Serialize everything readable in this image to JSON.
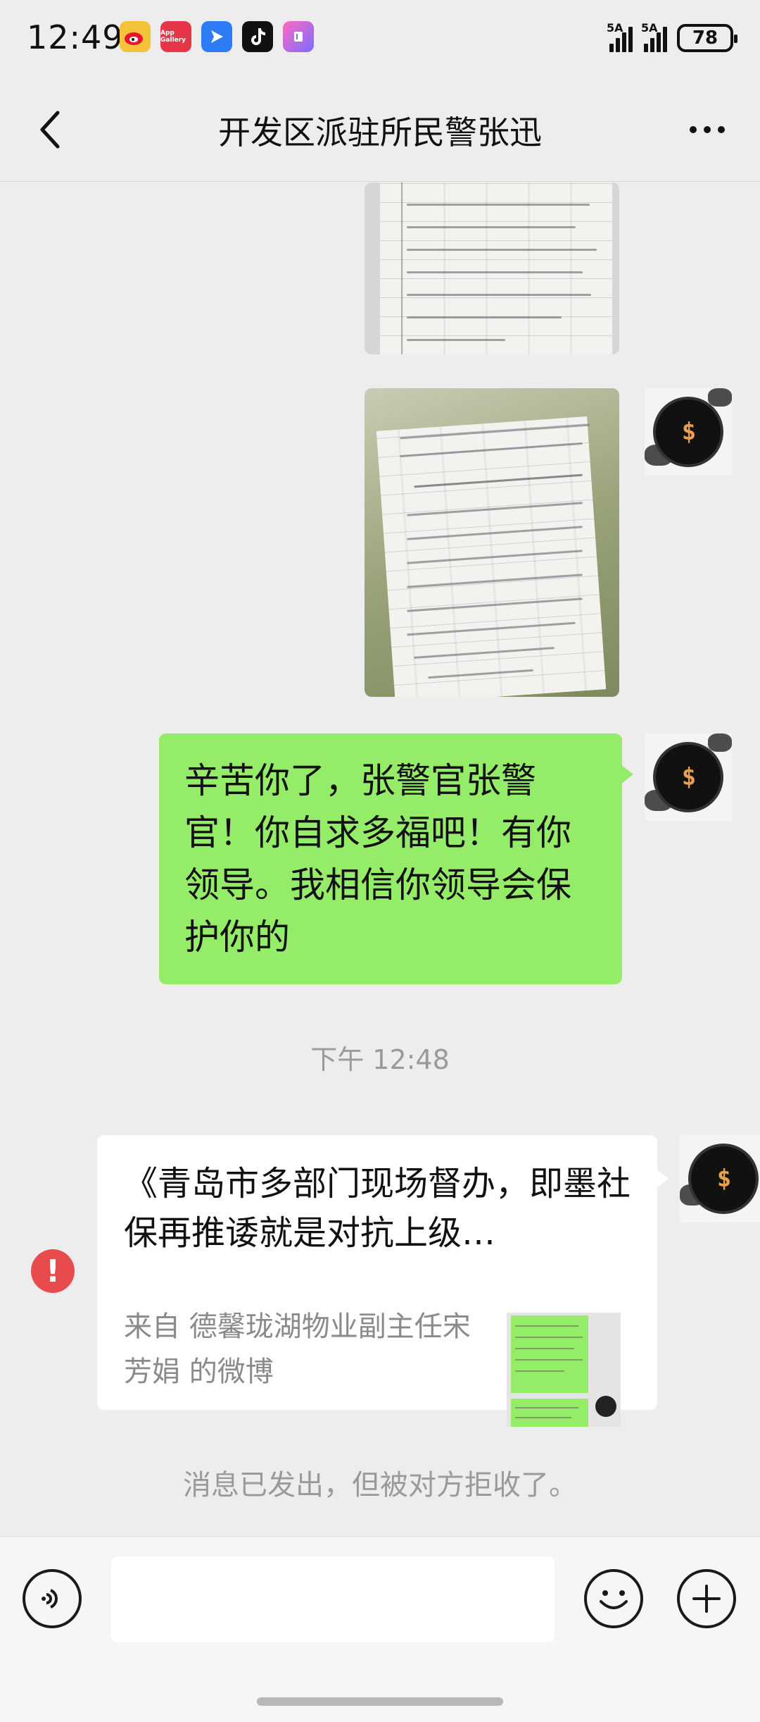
{
  "status_bar": {
    "time": "12:49",
    "app_icons": [
      "weibo-icon",
      "appgallery-icon",
      "direct-icon",
      "tiktok-icon",
      "app-icon"
    ],
    "app_gallery_label": "App Gallery",
    "sim1_label": "5A",
    "sim2_label": "5A",
    "battery": "78"
  },
  "header": {
    "title": "开发区派驻所民警张迅"
  },
  "messages": {
    "text_message": "辛苦你了，张警官张警官！你自求多福吧！有你领导。我相信你领导会保护你的",
    "timestamp": "下午 12:48",
    "link_card": {
      "title": "《青岛市多部门现场督办，即墨社保再推诿就是对抗上级…",
      "source": "来自 德馨珑湖物业副主任宋芳娟 的微博"
    },
    "rejected_notice": "消息已发出，但被对方拒收了。"
  },
  "input_bar": {
    "placeholder": ""
  },
  "colors": {
    "sent_bubble": "#95ec69",
    "background": "#ededed",
    "error": "#e84b4b"
  }
}
